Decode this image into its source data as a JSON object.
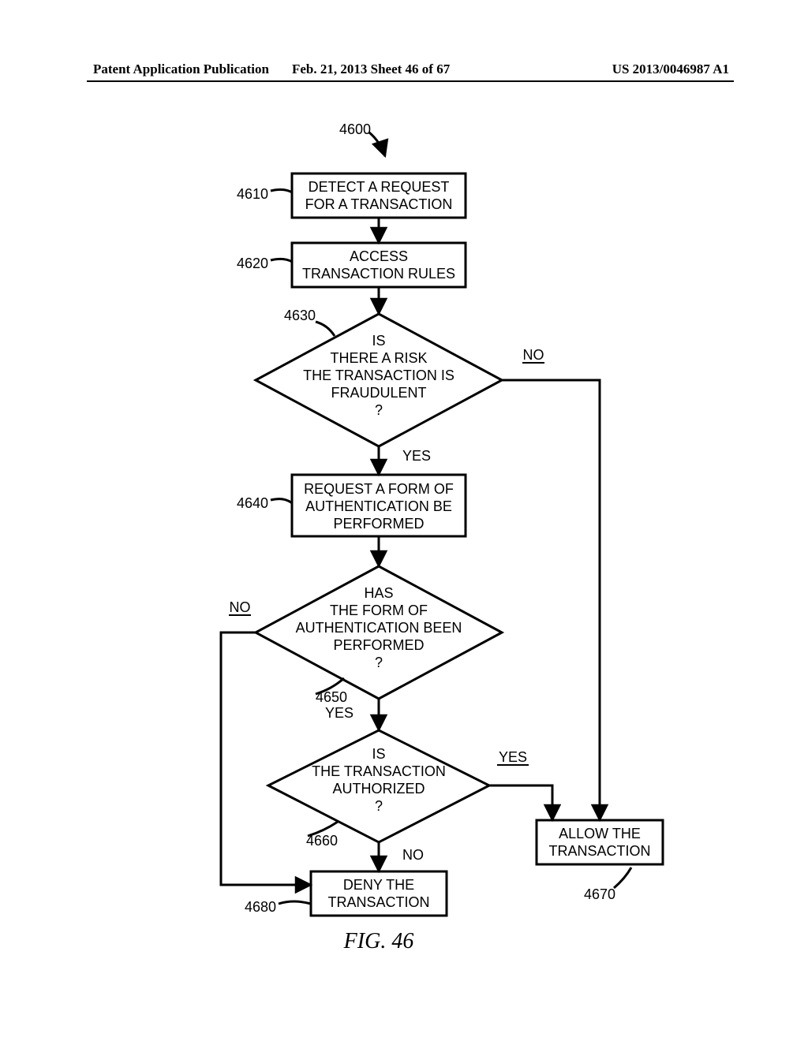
{
  "header": {
    "left": "Patent Application Publication",
    "mid": "Feb. 21, 2013   Sheet 46 of 67",
    "right": "US 2013/0046987 A1"
  },
  "figure": {
    "number": "4600",
    "caption": "FIG. 46",
    "labels": {
      "l4610": "4610",
      "l4620": "4620",
      "l4630": "4630",
      "l4640": "4640",
      "l4650": "4650",
      "l4660": "4660",
      "l4670": "4670",
      "l4680": "4680"
    },
    "nodes": {
      "n4610_a": "DETECT A REQUEST",
      "n4610_b": "FOR A TRANSACTION",
      "n4620_a": "ACCESS",
      "n4620_b": "TRANSACTION RULES",
      "n4630_a": "IS",
      "n4630_b": "THERE A RISK",
      "n4630_c": "THE TRANSACTION IS",
      "n4630_d": "FRAUDULENT",
      "n4630_e": "?",
      "n4640_a": "REQUEST A FORM OF",
      "n4640_b": "AUTHENTICATION BE",
      "n4640_c": "PERFORMED",
      "n4650_a": "HAS",
      "n4650_b": "THE FORM OF",
      "n4650_c": "AUTHENTICATION BEEN",
      "n4650_d": "PERFORMED",
      "n4650_e": "?",
      "n4660_a": "IS",
      "n4660_b": "THE TRANSACTION",
      "n4660_c": "AUTHORIZED",
      "n4660_d": "?",
      "n4670_a": "ALLOW THE",
      "n4670_b": "TRANSACTION",
      "n4680_a": "DENY THE",
      "n4680_b": "TRANSACTION"
    },
    "edges": {
      "yes": "YES",
      "no": "NO"
    }
  },
  "chart_data": {
    "type": "flowchart",
    "title": "FIG. 46",
    "figure_id": "4600",
    "nodes": [
      {
        "id": "4610",
        "type": "process",
        "text": "DETECT A REQUEST FOR A TRANSACTION"
      },
      {
        "id": "4620",
        "type": "process",
        "text": "ACCESS TRANSACTION RULES"
      },
      {
        "id": "4630",
        "type": "decision",
        "text": "IS THERE A RISK THE TRANSACTION IS FRAUDULENT ?"
      },
      {
        "id": "4640",
        "type": "process",
        "text": "REQUEST A FORM OF AUTHENTICATION BE PERFORMED"
      },
      {
        "id": "4650",
        "type": "decision",
        "text": "HAS THE FORM OF AUTHENTICATION BEEN PERFORMED ?"
      },
      {
        "id": "4660",
        "type": "decision",
        "text": "IS THE TRANSACTION AUTHORIZED ?"
      },
      {
        "id": "4670",
        "type": "process",
        "text": "ALLOW THE TRANSACTION"
      },
      {
        "id": "4680",
        "type": "process",
        "text": "DENY THE TRANSACTION"
      }
    ],
    "edges": [
      {
        "from": "4610",
        "to": "4620"
      },
      {
        "from": "4620",
        "to": "4630"
      },
      {
        "from": "4630",
        "to": "4640",
        "label": "YES"
      },
      {
        "from": "4630",
        "to": "4670",
        "label": "NO"
      },
      {
        "from": "4640",
        "to": "4650"
      },
      {
        "from": "4650",
        "to": "4660",
        "label": "YES"
      },
      {
        "from": "4650",
        "to": "4680",
        "label": "NO"
      },
      {
        "from": "4660",
        "to": "4670",
        "label": "YES"
      },
      {
        "from": "4660",
        "to": "4680",
        "label": "NO"
      }
    ]
  }
}
